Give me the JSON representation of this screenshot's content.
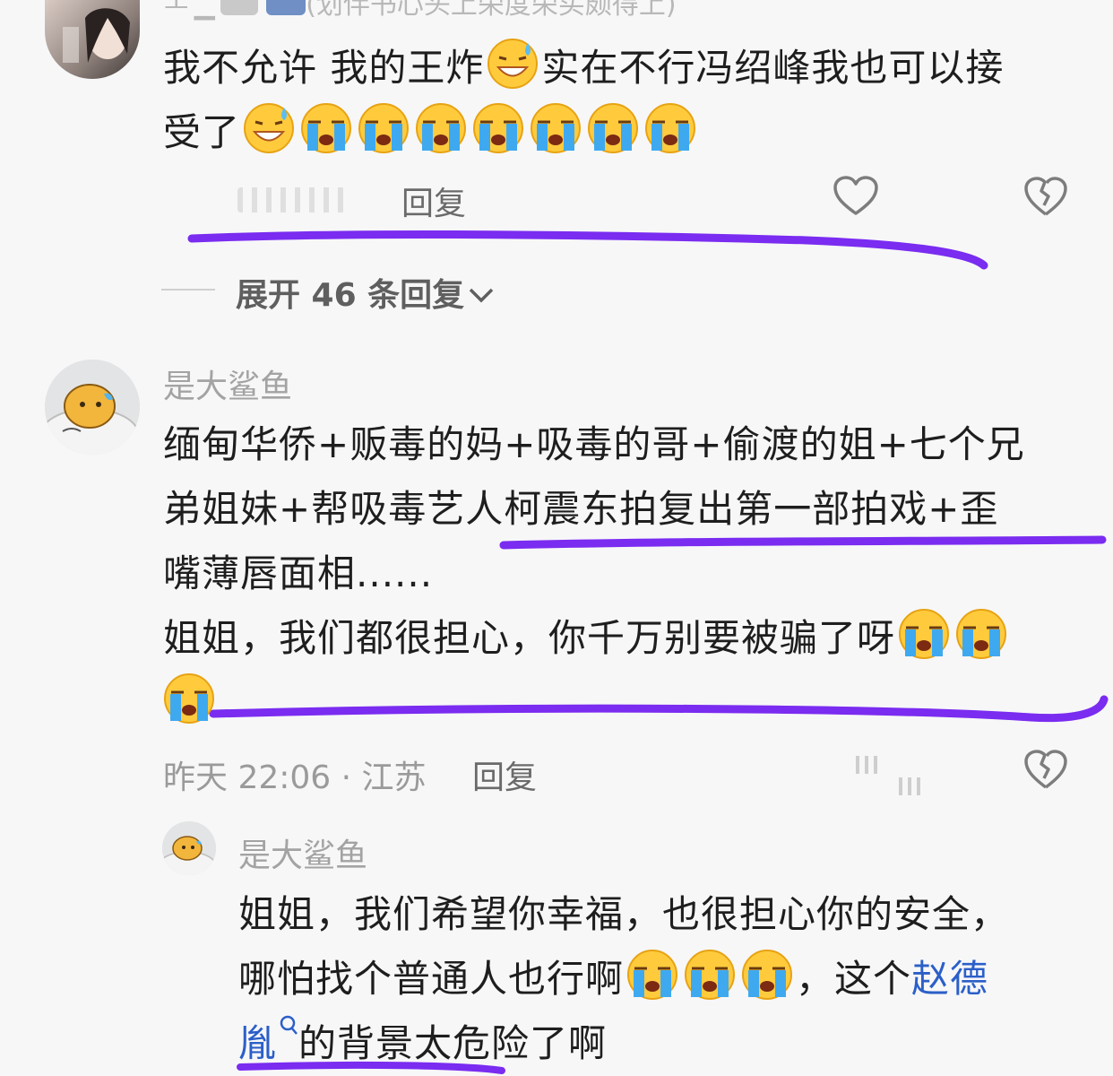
{
  "comment1": {
    "header_partial": "(划伴书心头上荣度荣买颇得上)",
    "text_line1_a": "我不允许 我的王炸",
    "text_line1_b": "实在不行冯绍峰我也可以接",
    "text_line2": "受了",
    "reply_label": "回复"
  },
  "expand_replies": {
    "label": "展开 46 条回复",
    "chevron": "chevron-down-icon"
  },
  "comment2": {
    "username": "是大鲨鱼",
    "line1": "缅甸华侨+贩毒的妈+吸毒的哥+偷渡的姐+七个兄",
    "line2": "弟姐妹+帮吸毒艺人柯震东拍复出第一部拍戏+歪",
    "line3": "嘴薄唇面相......",
    "line4": "姐姐，我们都很担心，你千万别要被骗了呀",
    "time_location": "昨天 22:06 · 江苏",
    "reply_label": "回复"
  },
  "reply1": {
    "username": "是大鲨鱼",
    "line1": "姐姐，我们希望你幸福，也很担心你的安全，",
    "line2_a": "哪怕找个普通人也行啊",
    "line2_b": "，这个",
    "link_a": "赵德",
    "link_b": "胤",
    "line3": "的背景太危险了啊"
  },
  "colors": {
    "annotation_purple": "#7a2cf0",
    "link_blue": "#2b5fc8"
  }
}
